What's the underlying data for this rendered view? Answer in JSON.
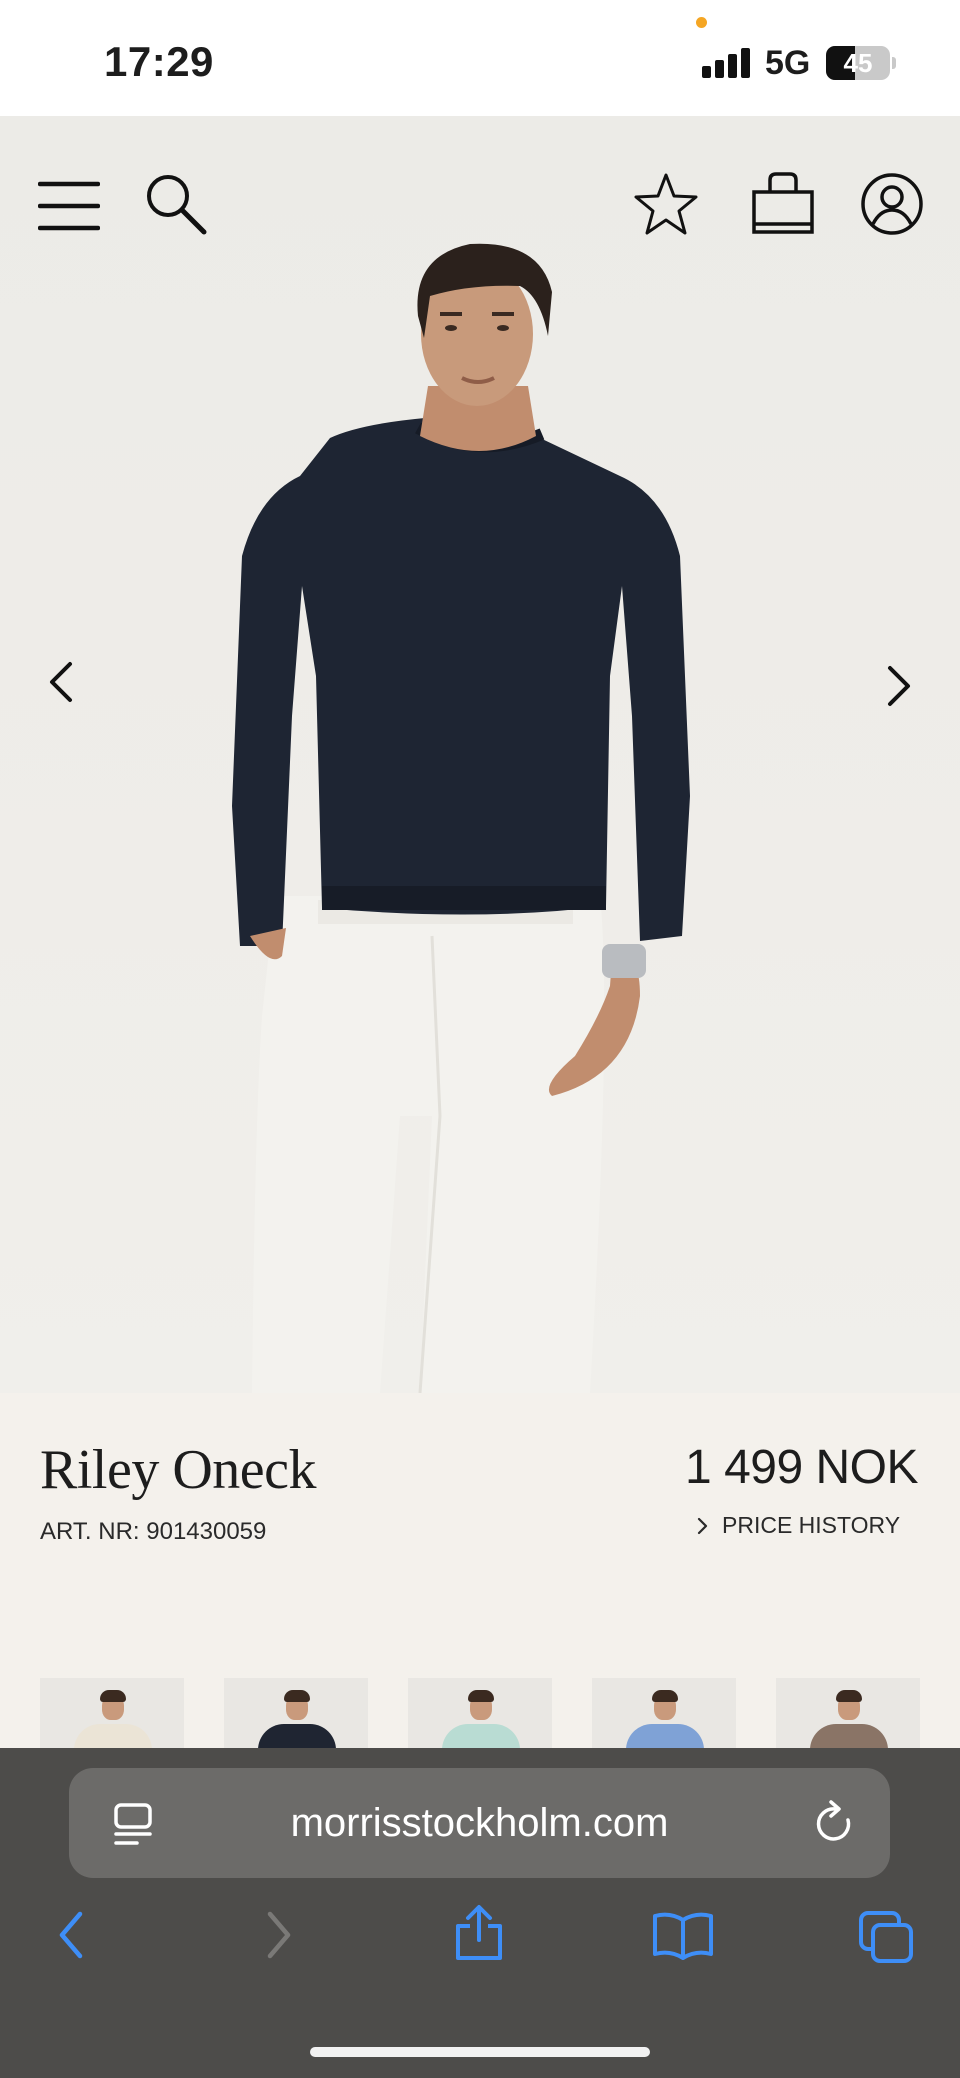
{
  "status_bar": {
    "time": "17:29",
    "network": "5G",
    "battery_level": "45",
    "battery_fraction": 0.45
  },
  "header": {
    "icons": [
      "menu-icon",
      "search-icon",
      "favorite-star-icon",
      "shopping-bag-icon",
      "account-icon"
    ]
  },
  "gallery": {
    "prev_icon": "chevron-left-icon",
    "next_icon": "chevron-right-icon",
    "image_subject": "model wearing navy crew neck sweater and white trousers"
  },
  "product": {
    "name": "Riley Oneck",
    "article_number": "ART. NR: 901430059",
    "price": "1 499 NOK",
    "price_history_label": "PRICE HISTORY"
  },
  "color_variants": [
    {
      "color": "#ebe4d6"
    },
    {
      "color": "#1f2532"
    },
    {
      "color": "#b9dcd3"
    },
    {
      "color": "#7fa2d6"
    },
    {
      "color": "#8a7466"
    }
  ],
  "browser": {
    "url": "morrisstockholm.com",
    "toolbar": [
      "back-icon",
      "forward-icon",
      "share-icon",
      "bookmarks-icon",
      "tabs-icon"
    ],
    "accent_color": "#3e8ef7"
  }
}
